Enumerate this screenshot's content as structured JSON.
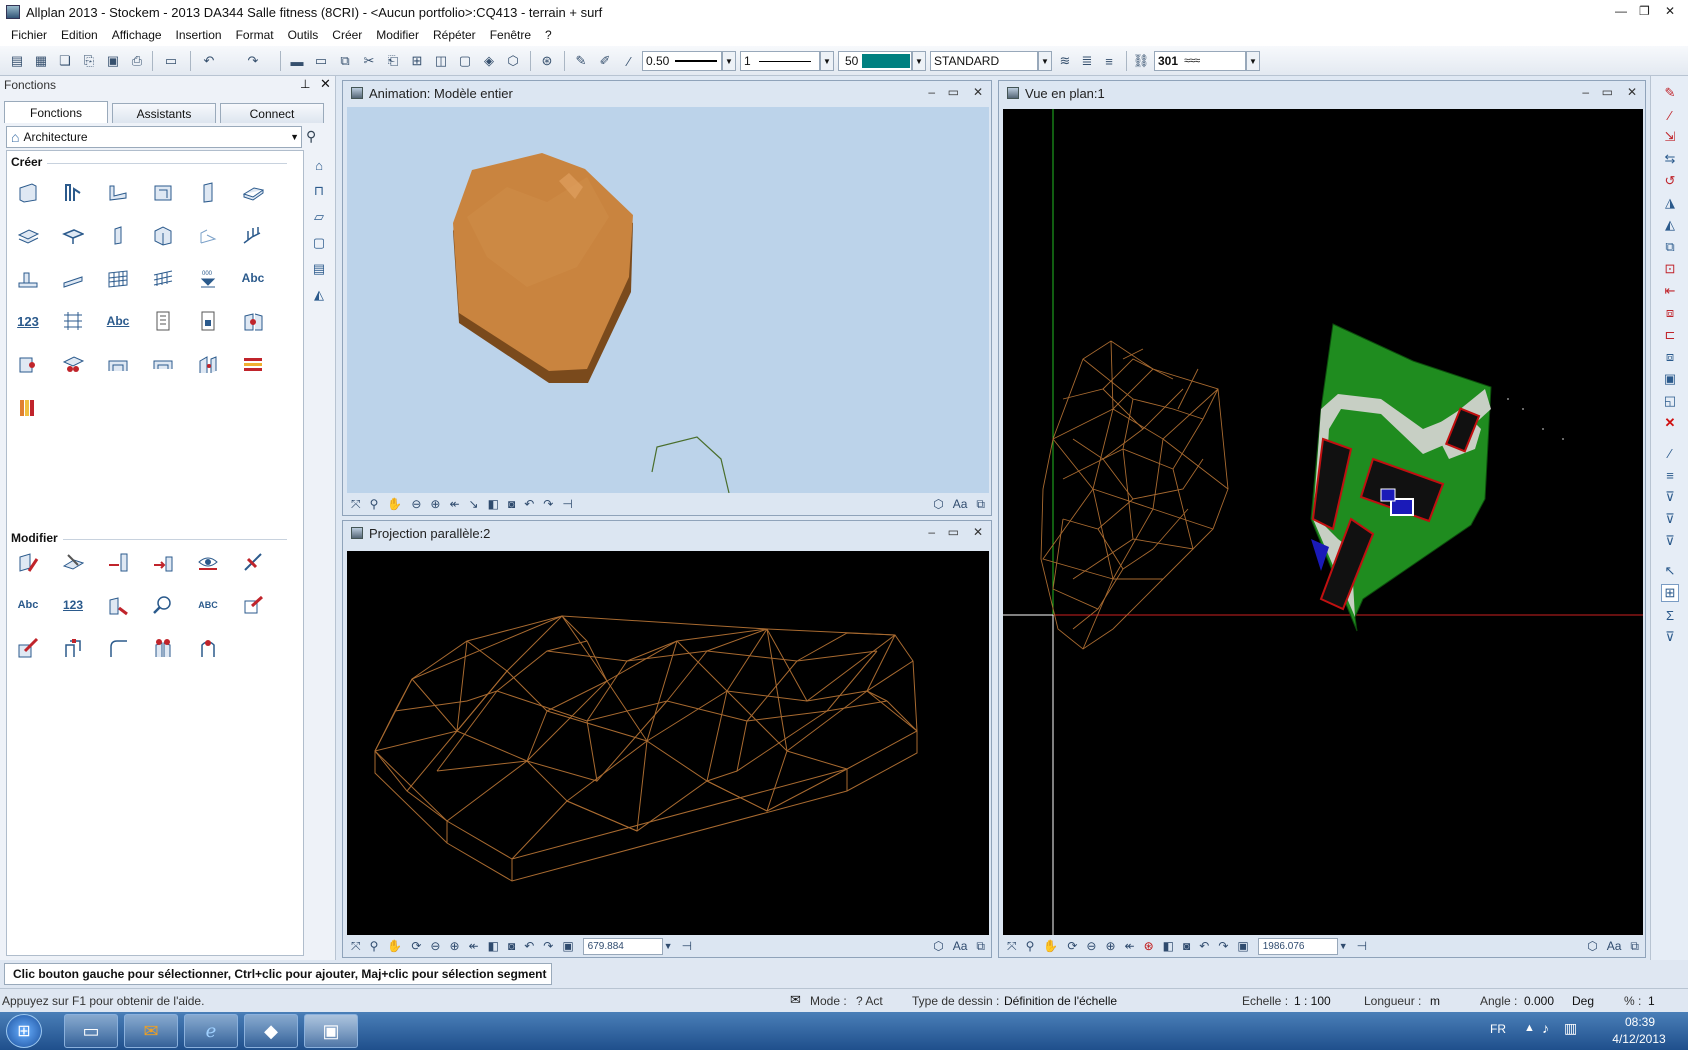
{
  "window": {
    "title": "Allplan 2013 - Stockem - 2013 DA344 Salle fitness (8CRI) - <Aucun portfolio>:CQ413 - terrain + surf"
  },
  "menu": [
    "Fichier",
    "Edition",
    "Affichage",
    "Insertion",
    "Format",
    "Outils",
    "Créer",
    "Modifier",
    "Répéter",
    "Fenêtre",
    "?"
  ],
  "toolbar": {
    "pen_thickness": "0.50",
    "line_type": "1",
    "color_number": "50",
    "color_swatch": "#008080",
    "format_name": "STANDARD",
    "layer_number": "301"
  },
  "palette": {
    "title": "Fonctions",
    "tabs": [
      "Fonctions",
      "Assistants",
      "Connect"
    ],
    "module": "Architecture",
    "section_create": "Créer",
    "section_modify": "Modifier",
    "create_text_icons": [
      "Abc",
      "123",
      "Abc"
    ],
    "modify_text_icons": [
      "Abc",
      "123",
      "ABC"
    ]
  },
  "viewports": {
    "animation": {
      "title": "Animation: Modèle entier",
      "background": "#bcd3ea"
    },
    "parallel": {
      "title": "Projection parallèle:2",
      "coord": "679.884"
    },
    "plan": {
      "title": "Vue en plan:1",
      "coord": "1986.076"
    }
  },
  "colors": {
    "terrain_wire": "#a86a30",
    "terrain_solid": "#c8843e",
    "site_green": "#1f8c1f",
    "building": "#111111",
    "axis_green": "#22bb22",
    "axis_red": "#cc2020"
  },
  "status": {
    "prompt": "Clic bouton gauche pour sélectionner, Ctrl+clic pour ajouter, Maj+clic pour sélection segment",
    "help": "Appuyez sur F1 pour obtenir de l'aide.",
    "mode_label": "Mode :",
    "mode_value": "? Act",
    "drawing_type_label": "Type de dessin :",
    "drawing_type_value": "Définition de l'échelle",
    "scale_label": "Echelle :",
    "scale_value": "1 : 100",
    "length_label": "Longueur :",
    "length_value": "m",
    "angle_label": "Angle :",
    "angle_value": "0.000",
    "angle_unit": "Deg",
    "percent_label": "% :",
    "percent_value": "1"
  },
  "taskbar": {
    "lang": "FR",
    "time": "08:39",
    "date": "4/12/2013"
  }
}
